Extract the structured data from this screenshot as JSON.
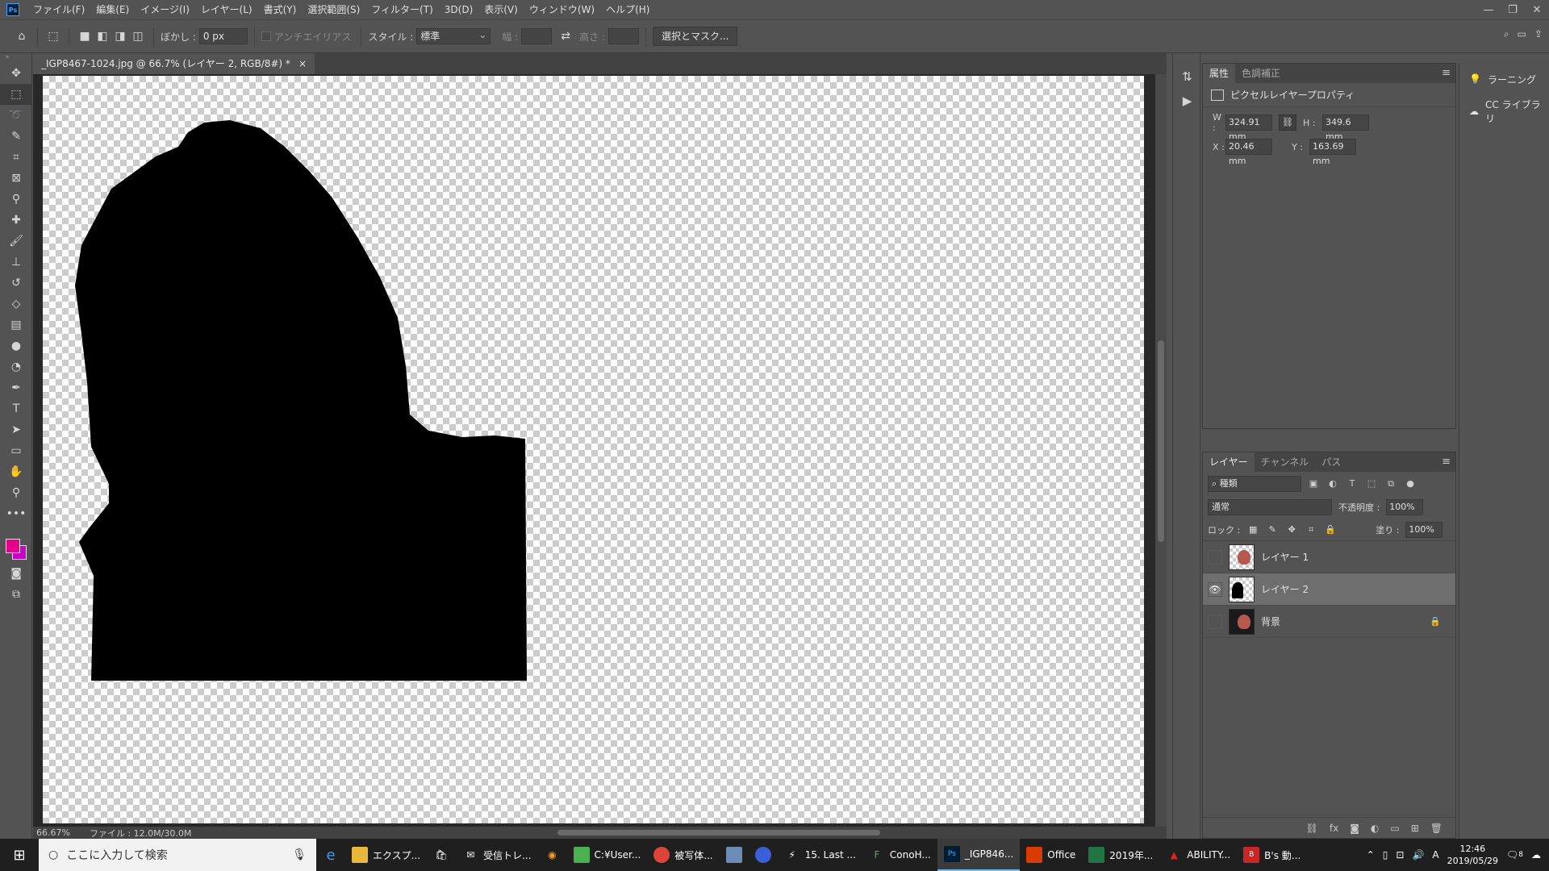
{
  "menu": {
    "logo": "Ps",
    "items": [
      "ファイル(F)",
      "編集(E)",
      "イメージ(I)",
      "レイヤー(L)",
      "書式(Y)",
      "選択範囲(S)",
      "フィルター(T)",
      "3D(D)",
      "表示(V)",
      "ウィンドウ(W)",
      "ヘルプ(H)"
    ]
  },
  "options": {
    "feather_label": "ぼかし :",
    "feather_value": "0 px",
    "antialias_label": "アンチエイリアス",
    "style_label": "スタイル :",
    "style_value": "標準",
    "width_label": "幅 :",
    "height_label": "高さ :",
    "select_mask_button": "選択とマスク..."
  },
  "document": {
    "tab_title": "_IGP8467-1024.jpg @ 66.7% (レイヤー 2, RGB/8#) *",
    "tab_close": "×",
    "zoom": "66.67%",
    "file_info": "ファイル : 12.0M/30.0M"
  },
  "properties": {
    "tab_active": "属性",
    "tab_other": "色調補正",
    "header": "ピクセルレイヤープロパティ",
    "w_label": "W :",
    "w_value": "324.91 mm",
    "h_label": "H :",
    "h_value": "349.6 mm",
    "x_label": "X :",
    "x_value": "20.46 mm",
    "y_label": "Y :",
    "y_value": "163.69 mm"
  },
  "side_panels": {
    "learn": "ラーニング",
    "cc_libraries": "CC ライブラリ"
  },
  "layers": {
    "tabs": [
      "レイヤー",
      "チャンネル",
      "パス"
    ],
    "kind_filter": "種類",
    "blend_mode": "通常",
    "opacity_label": "不透明度 :",
    "opacity_value": "100%",
    "lock_label": "ロック :",
    "fill_label": "塗り :",
    "fill_value": "100%",
    "items": [
      {
        "name": "レイヤー 1",
        "visible": false,
        "selected": false
      },
      {
        "name": "レイヤー 2",
        "visible": true,
        "selected": true
      },
      {
        "name": "背景",
        "visible": false,
        "selected": false,
        "locked": true
      }
    ]
  },
  "taskbar": {
    "search_placeholder": "ここに入力して検索",
    "items": [
      "エクスプ...",
      "受信トレ...",
      "C:¥User...",
      "被写体...",
      "15. Last ...",
      "ConoH...",
      "_IGP846...",
      "Office",
      "2019年...",
      "ABILITY...",
      "B's 動..."
    ],
    "time": "12:46",
    "date": "2019/05/29",
    "ime": "A",
    "notifications": "8"
  },
  "colors": {
    "foreground": "#e6008c",
    "background": "#c800c8"
  }
}
